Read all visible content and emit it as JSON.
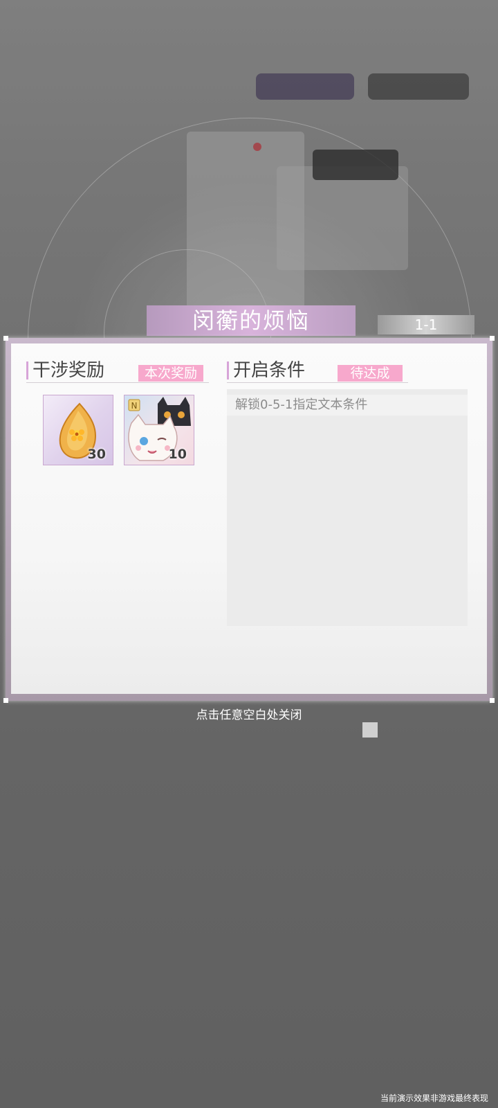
{
  "header": {
    "chapter_title": "闵蘅的烦恼",
    "stage_label": "1-1"
  },
  "rewards": {
    "section_title": "干涉奖励",
    "tag": "本次奖励",
    "items": [
      {
        "name": "amber-gem",
        "count": "30"
      },
      {
        "name": "cat-card",
        "count": "10"
      }
    ]
  },
  "conditions": {
    "section_title": "开启条件",
    "tag": "待达成",
    "entries": [
      "解锁0-5-1指定文本条件"
    ]
  },
  "footer": {
    "close_hint": "点击任意空白处关闭",
    "disclaimer": "当前演示效果非游戏最终表现"
  },
  "colors": {
    "accent_pink": "#f7a8cc",
    "title_purple": "#c9a8cf"
  }
}
